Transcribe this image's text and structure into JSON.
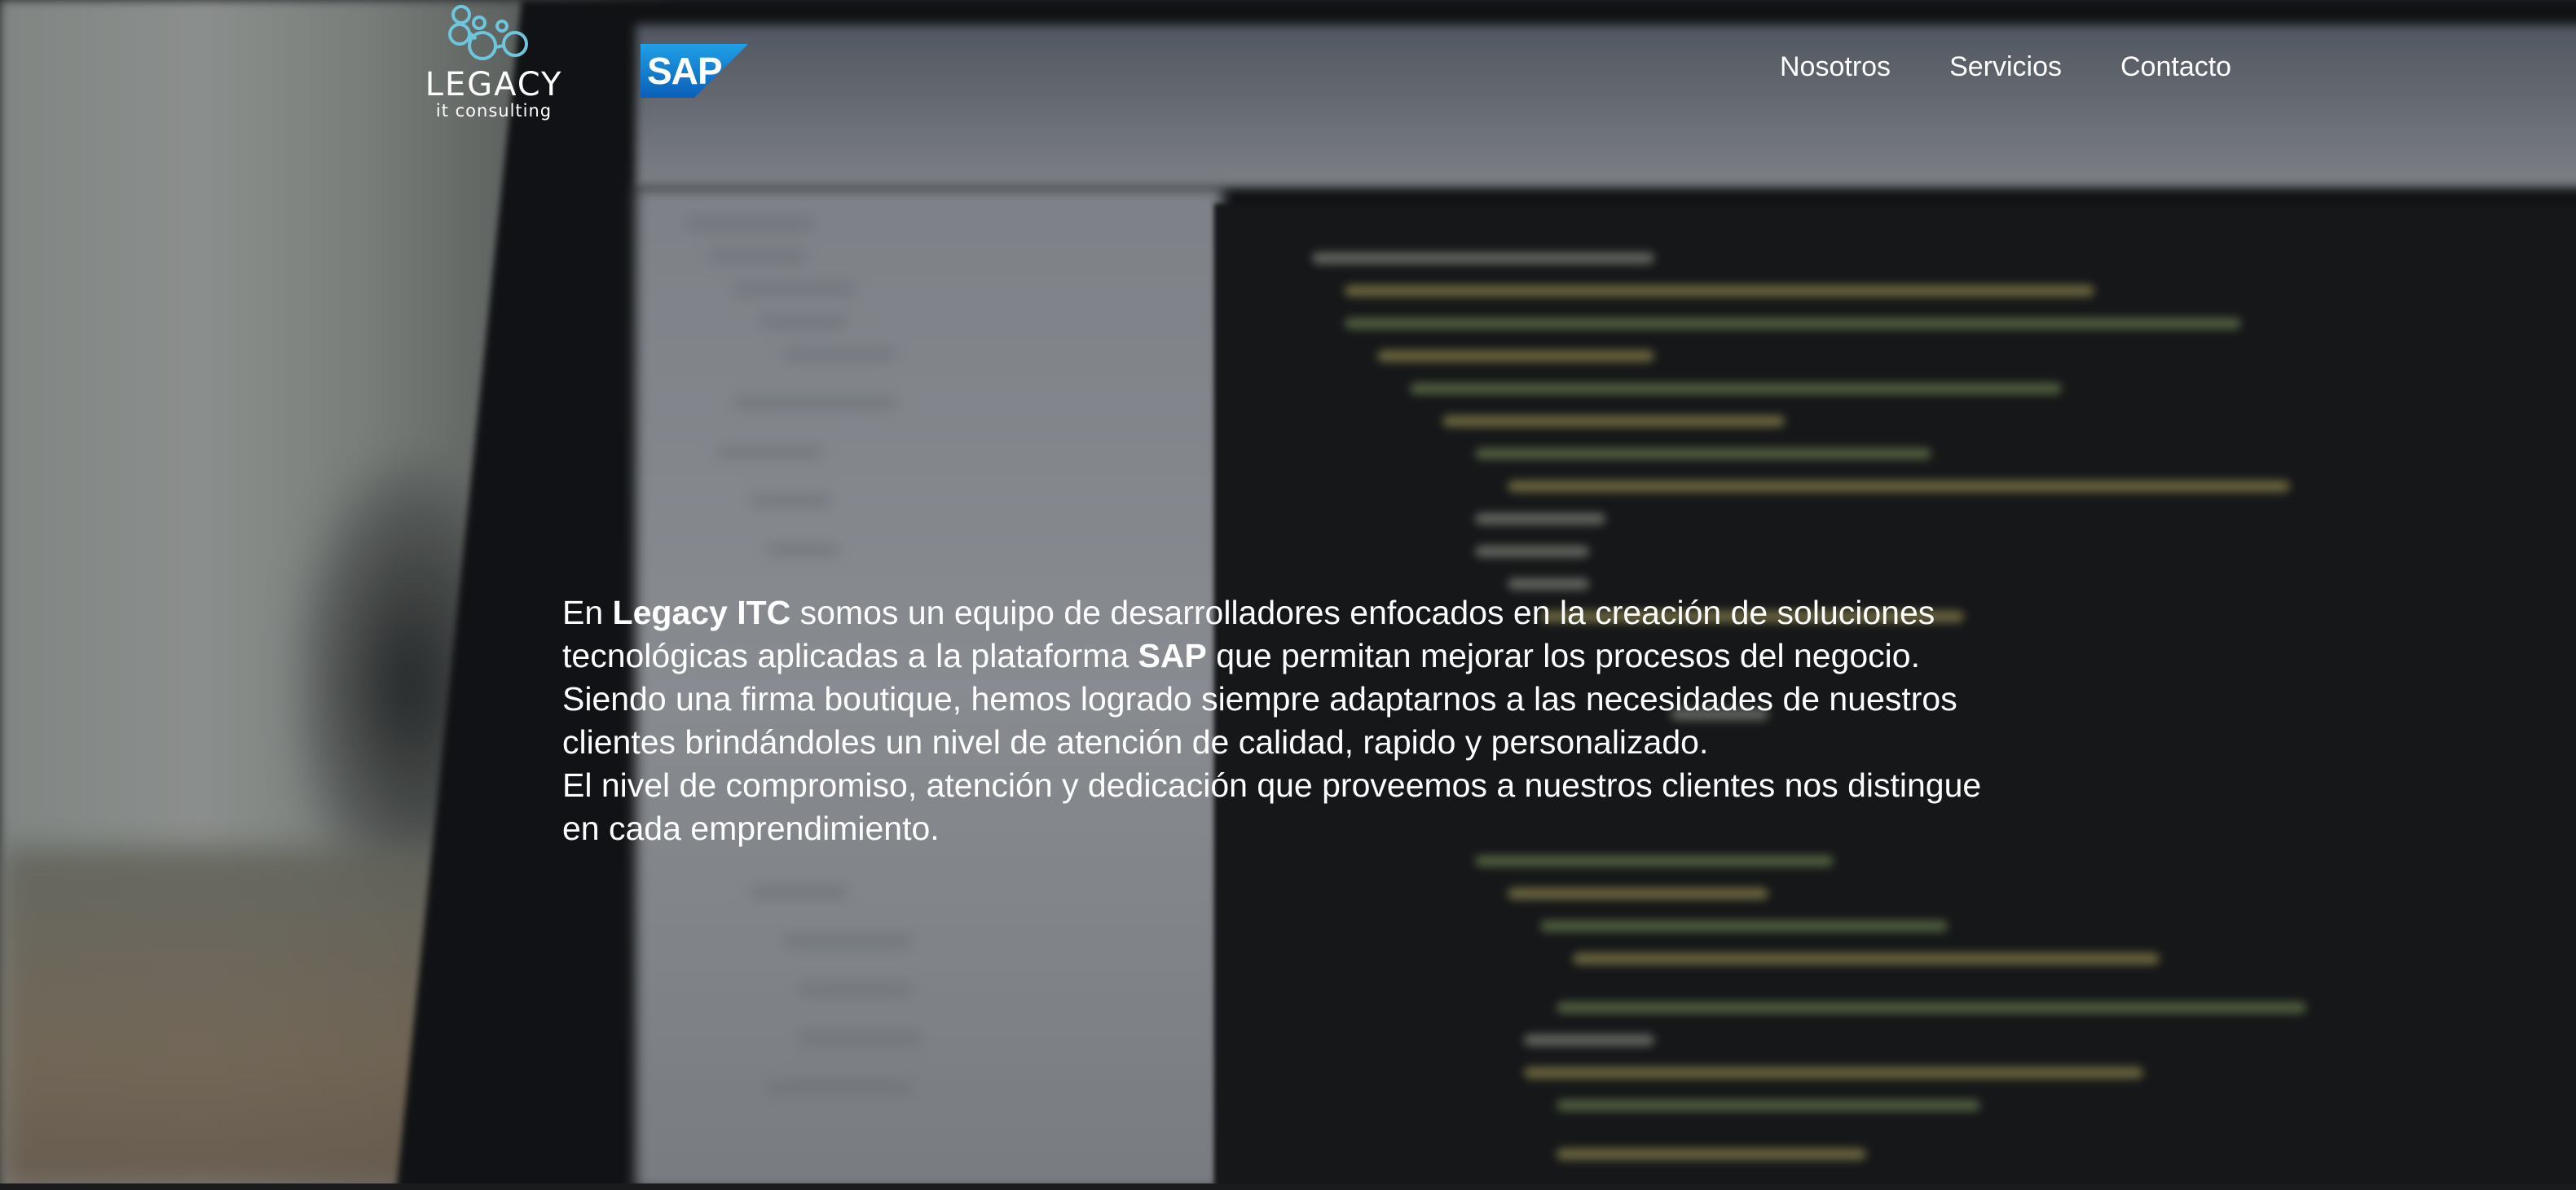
{
  "brand": {
    "logo_word": "LEGACY",
    "logo_tagline": "it consulting",
    "partner_logo": "SAP",
    "logo_color": "#6ec6dd",
    "sap_blue": "#1a73c8"
  },
  "nav": {
    "items": [
      {
        "label": "Nosotros"
      },
      {
        "label": "Servicios"
      },
      {
        "label": "Contacto"
      }
    ]
  },
  "intro": {
    "p1_pre": "En ",
    "p1_company": "Legacy ITC",
    "p1_mid": " somos un equipo de desarrolladores enfocados en la creación de soluciones tecnológicas aplicadas a la plataforma ",
    "p1_sap": "SAP",
    "p1_post": " que permitan mejorar los procesos del negocio.",
    "p2": "Siendo una firma boutique, hemos logrado siempre adaptarnos a las necesidades de nuestros clientes brindándoles un nivel de atención de calidad, rapido y personalizado.",
    "p3": "El nivel de compromiso, atención y dedicación que proveemos a nuestros clientes nos distingue en cada emprendimiento."
  }
}
